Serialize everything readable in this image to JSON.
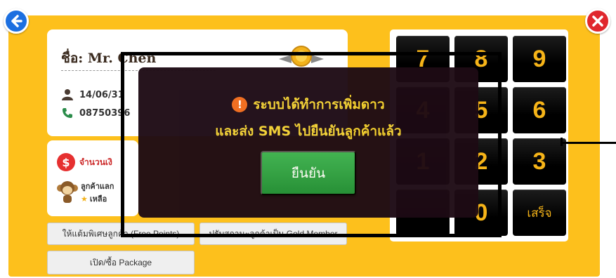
{
  "nav": {
    "back_icon": "back-arrow-icon",
    "close_icon": "close-x-icon"
  },
  "customer": {
    "name": "ชื่อ: Mr. Chen",
    "date": "14/06/31",
    "phone": "08750396",
    "medal_icon": "member-medal-icon"
  },
  "money": {
    "label": "จำนวนเงิ",
    "customer_line1": "ลูกค้าแลก",
    "customer_line2": "เหลือ"
  },
  "buttons": {
    "free_points": "ให้แต้มพิเศษลูกค้า (Free Points)",
    "gold_member": "ปรับสถานะลูกค้าเป็น Gold Member",
    "package": "เปิด/ซื้อ Package"
  },
  "keypad": {
    "keys": [
      "7",
      "8",
      "9",
      "4",
      "5",
      "6",
      "1",
      "2",
      "3",
      "",
      "0",
      "เสร็จ"
    ]
  },
  "dialog": {
    "line1": "ระบบได้ทำการเพิ่มดาว",
    "line2": "และส่ง SMS ไปยืนยันลูกค้าแล้ว",
    "confirm": "ยืนยัน"
  },
  "colors": {
    "panel": "#fdc01c",
    "key_text": "#f6b418",
    "dialog_bg": "#1d0a14",
    "dialog_text": "#f2d030",
    "confirm_bg": "#2a9f44"
  }
}
